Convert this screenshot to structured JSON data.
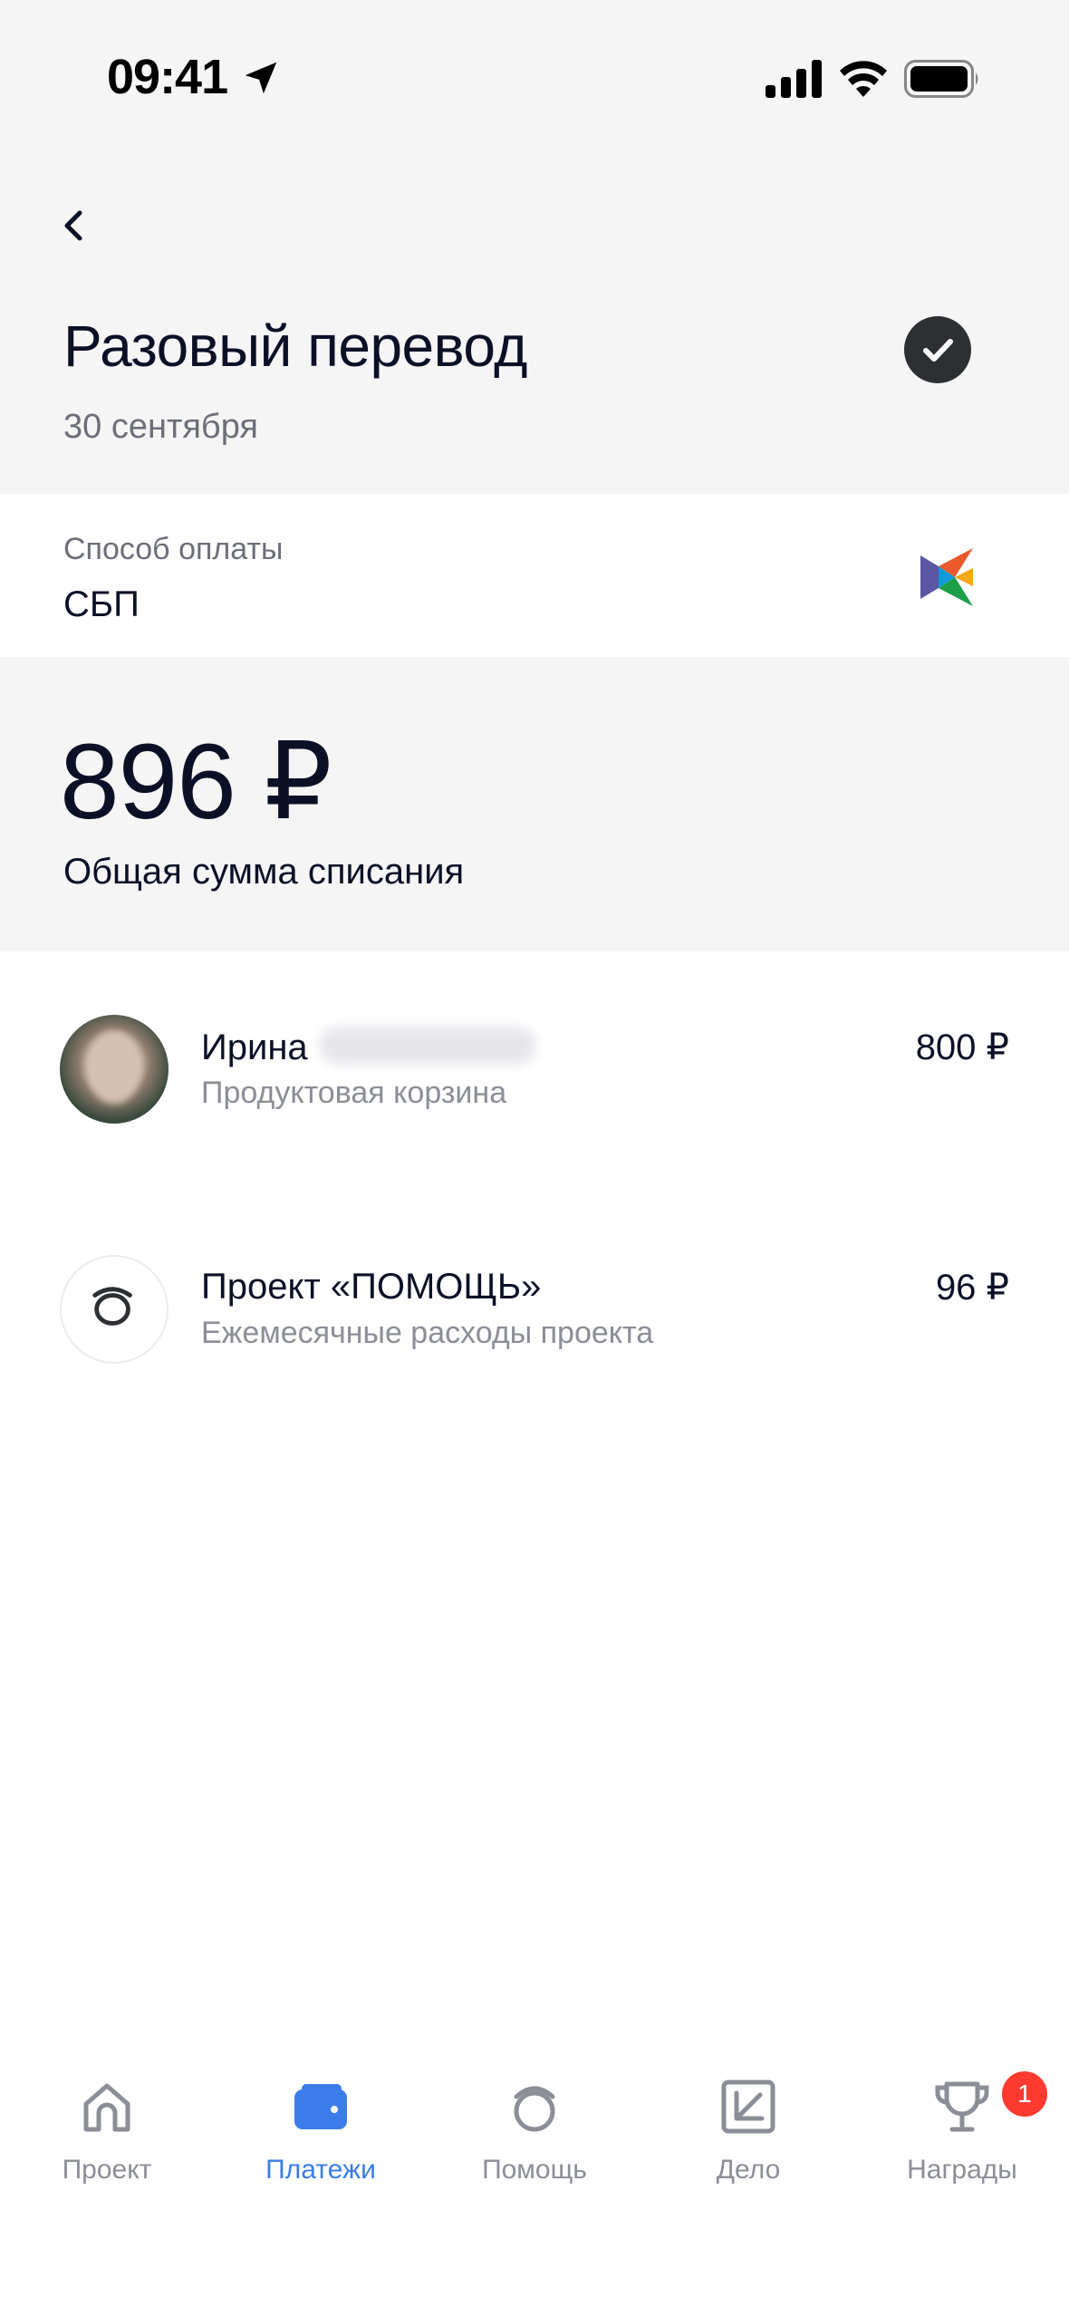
{
  "status_bar": {
    "time": "09:41"
  },
  "header": {
    "title": "Разовый перевод",
    "date": "30 сентября",
    "status_icon": "check-circle-icon"
  },
  "payment": {
    "label": "Способ оплаты",
    "method": "СБП",
    "logo_icon": "sbp-logo-icon"
  },
  "total": {
    "amount": "896 ₽",
    "label": "Общая сумма списания"
  },
  "items": [
    {
      "title": "Ирина",
      "subtitle": "Продуктовая корзина",
      "amount": "800 ₽",
      "avatar": "person-photo"
    },
    {
      "title": "Проект «ПОМОЩЬ»",
      "subtitle": "Ежемесячные расходы проекта",
      "amount": "96 ₽",
      "avatar": "project-logo-icon"
    }
  ],
  "nav": {
    "items": [
      {
        "label": "Проект",
        "icon": "home-icon",
        "active": false
      },
      {
        "label": "Платежи",
        "icon": "wallet-icon",
        "active": true
      },
      {
        "label": "Помощь",
        "icon": "help-logo-icon",
        "active": false
      },
      {
        "label": "Дело",
        "icon": "deal-icon",
        "active": false
      },
      {
        "label": "Награды",
        "icon": "trophy-icon",
        "active": false
      }
    ],
    "badge_count": "1"
  },
  "colors": {
    "accent": "#3c7ce8",
    "header_bg": "#f5f5f6",
    "badge": "#ff3b30",
    "text_primary": "#0b1026",
    "text_secondary": "#8b8e96"
  }
}
